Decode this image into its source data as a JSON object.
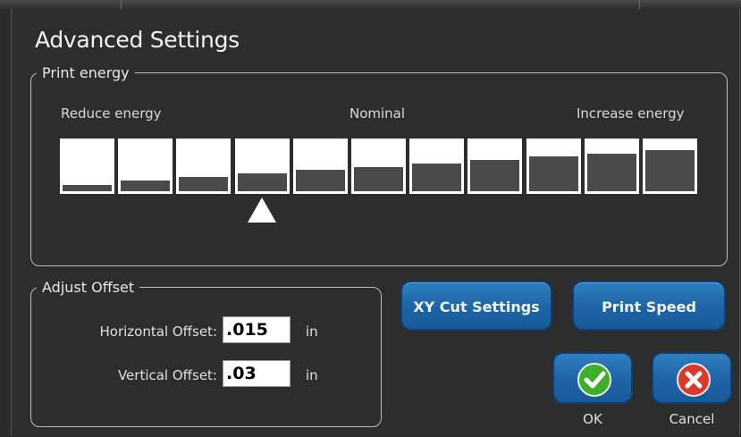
{
  "dialog": {
    "title": "Advanced Settings"
  },
  "print_energy": {
    "legend": "Print energy",
    "reduce_label": "Reduce energy",
    "nominal_label": "Nominal",
    "increase_label": "Increase energy",
    "levels": 11,
    "selected_index": 3,
    "fill_fractions": [
      0.13,
      0.21,
      0.29,
      0.35,
      0.42,
      0.49,
      0.55,
      0.62,
      0.69,
      0.75,
      0.82
    ]
  },
  "adjust_offset": {
    "legend": "Adjust Offset",
    "horizontal_label": "Horizontal Offset:",
    "horizontal_value": ".015",
    "vertical_label": "Vertical Offset:",
    "vertical_value": ".03",
    "unit": "in"
  },
  "buttons": {
    "xy_cut": "XY Cut Settings",
    "print_speed": "Print Speed",
    "ok": "OK",
    "cancel": "Cancel"
  },
  "colors": {
    "accent": "#1d64a6",
    "ok_green": "#3fae2a",
    "cancel_red": "#d93a2b"
  }
}
